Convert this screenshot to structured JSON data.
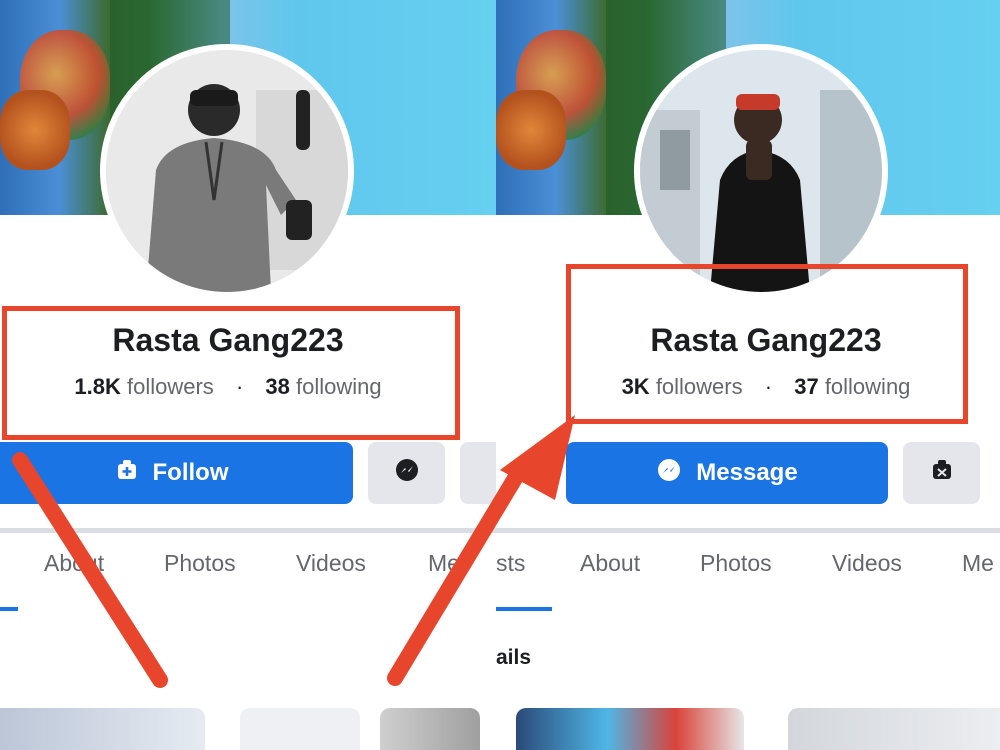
{
  "left_profile": {
    "name": "Rasta Gang223",
    "followers_count": "1.8K",
    "followers_label": "followers",
    "separator": "·",
    "following_count": "38",
    "following_label": "following",
    "primary_button": "Follow",
    "tabs": [
      "About",
      "Photos",
      "Videos",
      "Me"
    ]
  },
  "right_profile": {
    "name": "Rasta Gang223",
    "followers_count": "3K",
    "followers_label": "followers",
    "separator": "·",
    "following_count": "37",
    "following_label": "following",
    "primary_button": "Message",
    "tabs": [
      "sts",
      "About",
      "Photos",
      "Videos",
      "Me"
    ],
    "section_heading": "ails"
  },
  "colors": {
    "accent": "#1b74e4",
    "highlight": "#e8452d",
    "text": "#1c1e21",
    "muted": "#65676b"
  }
}
